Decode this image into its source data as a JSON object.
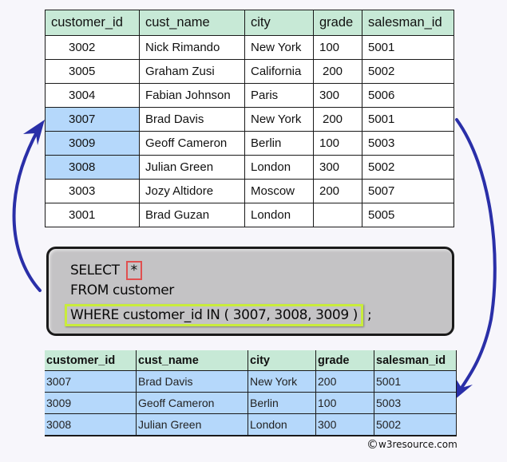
{
  "source_table": {
    "name": "customer",
    "columns": [
      "customer_id",
      "cust_name",
      "city",
      "grade",
      "salesman_id"
    ],
    "rows": [
      {
        "customer_id": "3002",
        "cust_name": "Nick Rimando",
        "city": "New York",
        "grade": "100",
        "salesman_id": "5001",
        "highlighted": false
      },
      {
        "customer_id": "3005",
        "cust_name": "Graham Zusi",
        "city": "California",
        "grade": "200",
        "salesman_id": "5002",
        "highlighted": false
      },
      {
        "customer_id": "3004",
        "cust_name": "Fabian Johnson",
        "city": "Paris",
        "grade": "300",
        "salesman_id": "5006",
        "highlighted": false
      },
      {
        "customer_id": "3007",
        "cust_name": "Brad Davis",
        "city": "New York",
        "grade": "200",
        "salesman_id": "5001",
        "highlighted": true
      },
      {
        "customer_id": "3009",
        "cust_name": "Geoff Cameron",
        "city": "Berlin",
        "grade": "100",
        "salesman_id": "5003",
        "highlighted": true
      },
      {
        "customer_id": "3008",
        "cust_name": "Julian Green",
        "city": "London",
        "grade": "300",
        "salesman_id": "5002",
        "highlighted": true
      },
      {
        "customer_id": "3003",
        "cust_name": "Jozy Altidore",
        "city": "Moscow",
        "grade": "200",
        "salesman_id": "5007",
        "highlighted": false
      },
      {
        "customer_id": "3001",
        "cust_name": "Brad Guzan",
        "city": "London",
        "grade": "",
        "salesman_id": "5005",
        "highlighted": false
      }
    ]
  },
  "sql": {
    "select_keyword": "SELECT",
    "select_target": "*",
    "from_line": "FROM customer",
    "where_clause": "WHERE customer_id IN ( 3007, 3008, 3009 )",
    "terminator": ";"
  },
  "result_table": {
    "columns": [
      "customer_id",
      "cust_name",
      "city",
      "grade",
      "salesman_id"
    ],
    "rows": [
      [
        "3007",
        "Brad Davis",
        "New York",
        "200",
        "5001"
      ],
      [
        "3009",
        "Geoff Cameron",
        "Berlin",
        "100",
        "5003"
      ],
      [
        "3008",
        "Julian Green",
        "London",
        "300",
        "5002"
      ]
    ]
  },
  "colors": {
    "header_bg": "#c7e9d6",
    "highlight_bg": "#b5d8fb",
    "arrow": "#2a2fa8",
    "star_outline": "#e05050",
    "where_outline": "#c9ec3c",
    "sql_box_bg": "#c4c3c5"
  },
  "footer": {
    "copyright_symbol": "©",
    "copyright_text": "w3resource.com"
  }
}
